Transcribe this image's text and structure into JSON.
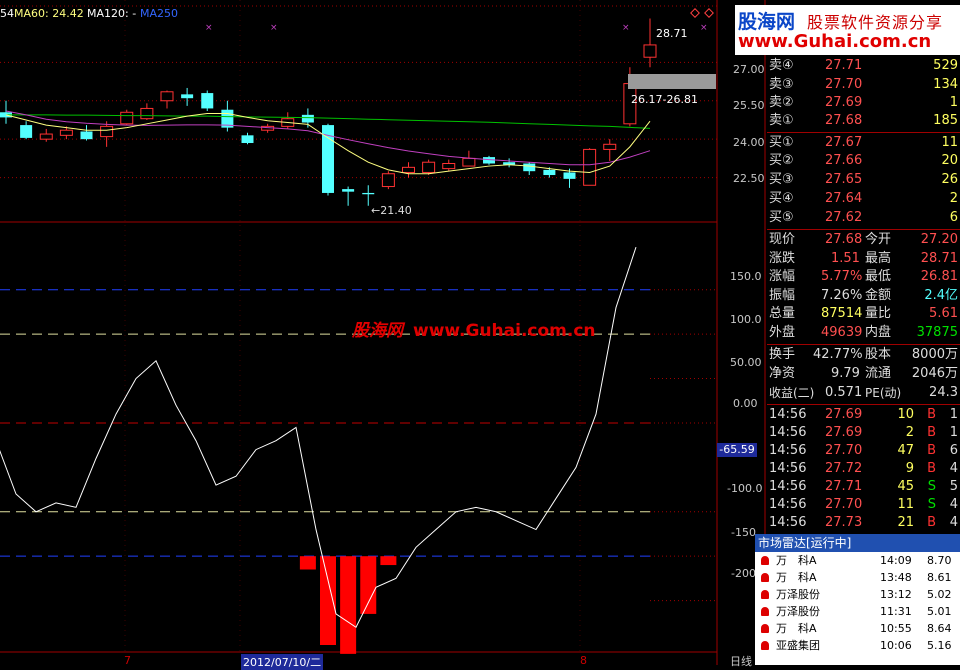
{
  "ma_legend": {
    "ma_first": "54",
    "ma60": "MA60: 24.42",
    "ma120": "MA120: -",
    "ma250": "MA250"
  },
  "price_annotations": {
    "high": "28.71",
    "range": "26.17-26.81",
    "low": "←21.40"
  },
  "price_axis": [
    "27.00",
    "25.50",
    "24.00",
    "22.50"
  ],
  "indicator_axis": [
    "150.0",
    "100.0",
    "50.00",
    "0.00",
    "-100.0",
    "-150",
    "-200"
  ],
  "indicator_current": "-65.59",
  "date_axis": {
    "tick1": "7",
    "date": "2012/07/10/二",
    "tick2": "8",
    "period": "日线"
  },
  "banner": {
    "logo": "股海网",
    "slogan": "股票软件资源分享",
    "url": "www.Guhai.com.cn"
  },
  "watermark": {
    "name": "股海网",
    "url": "www.Guhai.com.cn"
  },
  "colors": {
    "up": "#ff3232",
    "down": "#54ffff",
    "ma60": "#00c000",
    "ma_purple": "#c040c0",
    "ma_yellow": "#ffff80",
    "grid": "#a00000"
  },
  "order_book": {
    "asks": [
      {
        "label": "卖④",
        "price": "27.71",
        "vol": "529"
      },
      {
        "label": "卖③",
        "price": "27.70",
        "vol": "134"
      },
      {
        "label": "卖②",
        "price": "27.69",
        "vol": "1"
      },
      {
        "label": "卖①",
        "price": "27.68",
        "vol": "185"
      }
    ],
    "bids": [
      {
        "label": "买①",
        "price": "27.67",
        "vol": "11"
      },
      {
        "label": "买②",
        "price": "27.66",
        "vol": "20"
      },
      {
        "label": "买③",
        "price": "27.65",
        "vol": "26"
      },
      {
        "label": "买④",
        "price": "27.64",
        "vol": "2"
      },
      {
        "label": "买⑤",
        "price": "27.62",
        "vol": "6"
      }
    ]
  },
  "stats": [
    {
      "l1": "现价",
      "v1": "27.68",
      "l2": "今开",
      "v2": "27.20"
    },
    {
      "l1": "涨跌",
      "v1": "1.51",
      "l2": "最高",
      "v2": "28.71"
    },
    {
      "l1": "涨幅",
      "v1": "5.77%",
      "l2": "最低",
      "v2": "26.81"
    },
    {
      "l1": "振幅",
      "v1": "7.26%",
      "l2": "金额",
      "v2": "2.4亿"
    },
    {
      "l1": "总量",
      "v1": "87514",
      "l2": "量比",
      "v2": "5.61"
    },
    {
      "l1": "外盘",
      "v1": "49639",
      "l2": "内盘",
      "v2": "37875"
    }
  ],
  "fundamentals": [
    {
      "l1": "换手",
      "v1": "42.77%",
      "l2": "股本",
      "v2": "8000万"
    },
    {
      "l1": "净资",
      "v1": "9.79",
      "l2": "流通",
      "v2": "2046万"
    },
    {
      "l1": "收益(二)",
      "v1": "0.571",
      "l2": "PE(动)",
      "v2": "24.3"
    }
  ],
  "ticks": [
    {
      "time": "14:56",
      "price": "27.69",
      "vol": "10",
      "side": "B",
      "n": "1"
    },
    {
      "time": "14:56",
      "price": "27.69",
      "vol": "2",
      "side": "B",
      "n": "1"
    },
    {
      "time": "14:56",
      "price": "27.70",
      "vol": "47",
      "side": "B",
      "n": "6"
    },
    {
      "time": "14:56",
      "price": "27.72",
      "vol": "9",
      "side": "B",
      "n": "4"
    },
    {
      "time": "14:56",
      "price": "27.71",
      "vol": "45",
      "side": "S",
      "n": "5"
    },
    {
      "time": "14:56",
      "price": "27.70",
      "vol": "11",
      "side": "S",
      "n": "4"
    },
    {
      "time": "14:56",
      "price": "27.73",
      "vol": "21",
      "side": "B",
      "n": "4"
    }
  ],
  "radar": {
    "title": "市场雷达[运行中]",
    "items": [
      {
        "name": "万　科A",
        "time": "14:09",
        "val": "8.70"
      },
      {
        "name": "万　科A",
        "time": "13:48",
        "val": "8.61"
      },
      {
        "name": "万泽股份",
        "time": "13:12",
        "val": "5.02"
      },
      {
        "name": "万泽股份",
        "time": "11:31",
        "val": "5.01"
      },
      {
        "name": "万　科A",
        "time": "10:55",
        "val": "8.64"
      },
      {
        "name": "亚盛集团",
        "time": "10:06",
        "val": "5.16"
      }
    ]
  },
  "chart_data": [
    {
      "type": "candlestick",
      "ohlc": [
        [
          25.05,
          25.5,
          24.6,
          24.85
        ],
        [
          24.55,
          24.7,
          24.0,
          24.05
        ],
        [
          24.0,
          24.4,
          23.9,
          24.2
        ],
        [
          24.15,
          24.5,
          24.0,
          24.35
        ],
        [
          24.3,
          24.55,
          23.95,
          24.0
        ],
        [
          24.1,
          24.7,
          23.7,
          24.5
        ],
        [
          24.6,
          25.15,
          24.55,
          25.05
        ],
        [
          24.8,
          25.4,
          24.75,
          25.2
        ],
        [
          25.5,
          25.9,
          25.2,
          25.85
        ],
        [
          25.75,
          26.0,
          25.3,
          25.6
        ],
        [
          25.8,
          25.9,
          25.1,
          25.2
        ],
        [
          25.15,
          25.5,
          24.3,
          24.45
        ],
        [
          24.15,
          24.25,
          23.8,
          23.85
        ],
        [
          24.35,
          24.6,
          24.25,
          24.5
        ],
        [
          24.5,
          25.05,
          24.4,
          24.8
        ],
        [
          24.95,
          25.2,
          24.45,
          24.65
        ],
        [
          24.55,
          24.6,
          21.8,
          21.9
        ],
        [
          22.05,
          22.15,
          21.4,
          21.95
        ],
        [
          21.9,
          22.2,
          21.4,
          21.85
        ],
        [
          22.15,
          22.75,
          22.05,
          22.65
        ],
        [
          22.7,
          23.1,
          22.5,
          22.9
        ],
        [
          22.7,
          23.2,
          22.6,
          23.1
        ],
        [
          22.85,
          23.2,
          22.75,
          23.05
        ],
        [
          22.95,
          23.55,
          22.95,
          23.25
        ],
        [
          23.3,
          23.35,
          23.0,
          23.05
        ],
        [
          23.1,
          23.25,
          22.9,
          23.0
        ],
        [
          23.05,
          23.1,
          22.6,
          22.75
        ],
        [
          22.8,
          22.9,
          22.5,
          22.6
        ],
        [
          22.7,
          22.85,
          22.1,
          22.45
        ],
        [
          22.2,
          23.65,
          22.2,
          23.6
        ],
        [
          23.6,
          24.0,
          23.15,
          23.8
        ],
        [
          24.6,
          26.81,
          24.5,
          26.17
        ],
        [
          27.2,
          28.71,
          26.81,
          27.68
        ]
      ],
      "ma60": [
        24.95,
        24.95,
        24.95,
        24.94,
        24.94,
        24.93,
        24.92,
        24.92,
        24.91,
        24.9,
        24.9,
        24.88,
        24.87,
        24.86,
        24.85,
        24.84,
        24.82,
        24.8,
        24.78,
        24.76,
        24.74,
        24.72,
        24.7,
        24.68,
        24.66,
        24.63,
        24.6,
        24.58,
        24.55,
        24.52,
        24.5,
        24.46,
        24.42
      ],
      "ma_purple": [
        25.1,
        24.95,
        24.78,
        24.68,
        24.62,
        24.58,
        24.55,
        24.54,
        24.55,
        24.56,
        24.56,
        24.55,
        24.5,
        24.45,
        24.4,
        24.33,
        24.15,
        23.98,
        23.82,
        23.67,
        23.54,
        23.43,
        23.33,
        23.26,
        23.2,
        23.15,
        23.1,
        23.05,
        23.0,
        23.0,
        23.1,
        23.3,
        23.55
      ],
      "ma_yellow": [
        24.95,
        24.75,
        24.55,
        24.45,
        24.35,
        24.35,
        24.45,
        24.6,
        24.75,
        24.9,
        25.0,
        25.0,
        24.85,
        24.72,
        24.65,
        24.58,
        24.05,
        23.55,
        23.1,
        22.8,
        22.65,
        22.65,
        22.75,
        22.85,
        22.95,
        23.0,
        22.95,
        22.85,
        22.75,
        22.7,
        22.95,
        23.7,
        24.7
      ],
      "ylim": [
        21.0,
        29.2
      ]
    },
    {
      "type": "line",
      "name": "CCI",
      "values": [
        -20,
        -80,
        -100,
        -90,
        -95,
        -40,
        10,
        50,
        70,
        20,
        -20,
        -70,
        -60,
        -30,
        -20,
        -5,
        -120,
        -215,
        -230,
        -185,
        -175,
        -140,
        -120,
        -100,
        -95,
        -100,
        -110,
        -120,
        -85,
        -50,
        10,
        130,
        198
      ],
      "bars": [
        -165,
        -250,
        -260,
        -215,
        -160
      ],
      "levels": [
        150,
        100,
        0,
        -100,
        -150
      ],
      "ylim": [
        -250,
        215
      ]
    }
  ]
}
